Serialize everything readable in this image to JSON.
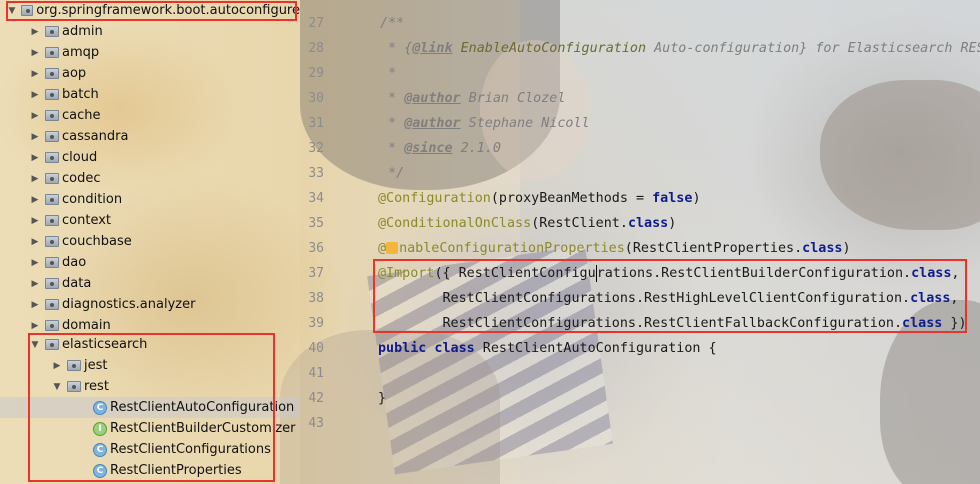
{
  "tree": {
    "root": "org.springframework.boot.autoconfigure",
    "packages": [
      "admin",
      "amqp",
      "aop",
      "batch",
      "cache",
      "cassandra",
      "cloud",
      "codec",
      "condition",
      "context",
      "couchbase",
      "dao",
      "data",
      "diagnostics.analyzer",
      "domain"
    ],
    "elasticsearch": {
      "label": "elasticsearch",
      "jest": "jest",
      "rest": "rest",
      "classes": [
        {
          "name": "RestClientAutoConfiguration",
          "kind": "class",
          "icon": "C"
        },
        {
          "name": "RestClientBuilderCustomizer",
          "kind": "interface",
          "icon": "I"
        },
        {
          "name": "RestClientConfigurations",
          "kind": "class",
          "icon": "C"
        },
        {
          "name": "RestClientProperties",
          "kind": "class",
          "icon": "C"
        }
      ]
    }
  },
  "editor": {
    "line_numbers": [
      "27",
      "28",
      "29",
      "30",
      "31",
      "32",
      "33",
      "34",
      "35",
      "36",
      "37",
      "38",
      "39",
      "40",
      "41",
      "42",
      "43"
    ],
    "l27": "/**",
    "l28_link_tag": "@link",
    "l28_link_text": "EnableAutoConfiguration",
    "l28_rest": " Auto-configuration} for Elasticsearch RES",
    "l28_pre": " * {",
    "l29": " *",
    "l30_tag": "@author",
    "l30_text": " Brian Clozel",
    "l31_tag": "@author",
    "l31_text": " Stephane Nicoll",
    "l32_tag": "@since",
    "l32_text": " 2.1.0",
    "l33": " */",
    "l34_ann": "@Configuration",
    "l34_mid": "(proxyBeanMethods = ",
    "l34_kw": "false",
    "l34_end": ")",
    "l35_ann": "@ConditionalOnClass",
    "l35_mid": "(RestClient.",
    "l35_kw": "class",
    "l35_end": ")",
    "l36_ann_a": "@",
    "l36_ann_b": "nableConfigurationProperties",
    "l36_mid": "(RestClientProperties.",
    "l36_kw": "class",
    "l36_end": ")",
    "l37_ann": "@Import",
    "l37_mid_a": "({ RestClientConfigu",
    "l37_mid_b": "rations.RestClientBuilderConfiguration.",
    "l37_kw": "class",
    "l37_end": ",",
    "l38_mid": "        RestClientConfigurations.RestHighLevelClientConfiguration.",
    "l38_kw": "class",
    "l38_end": ",",
    "l39_mid": "        RestClientConfigurations.RestClientFallbackConfiguration.",
    "l39_kw": "class",
    "l39_end": " })",
    "l40_kw": "public class",
    "l40_rest": " RestClientAutoConfiguration {",
    "l42": "}"
  },
  "colors": {
    "highlight_box": "#e8342a",
    "keyword": "#0f1b8f",
    "annotation": "#8a8a2a",
    "comment": "#7f7f7f"
  }
}
